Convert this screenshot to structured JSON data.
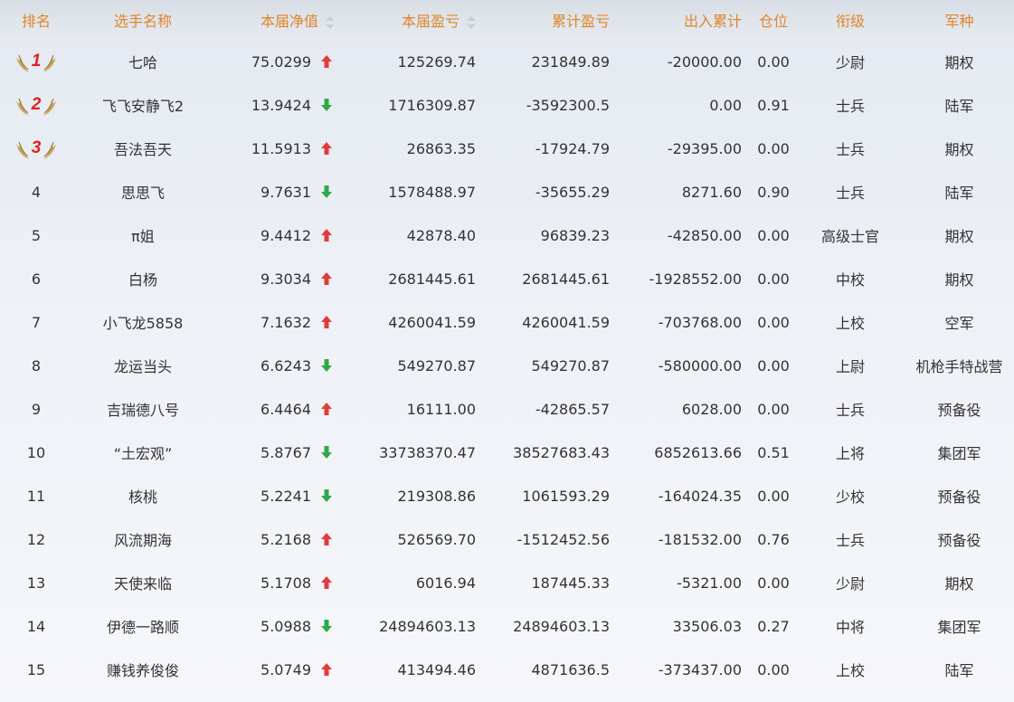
{
  "colors": {
    "header_text": "#e0862a",
    "up": "#e23b3b",
    "down": "#2fa84a",
    "medal_gold": "#c9a25a",
    "rank_red": "#e02020"
  },
  "headers": {
    "rank": "排名",
    "name": "选手名称",
    "nav": "本届净值",
    "pnl": "本届盈亏",
    "cum_pnl": "累计盈亏",
    "flow": "出入累计",
    "position": "仓位",
    "title": "衔级",
    "branch": "军种"
  },
  "rows": [
    {
      "rank": "1",
      "name": "七哈",
      "nav": "75.0299",
      "trend": "up",
      "pnl": "125269.74",
      "cum_pnl": "231849.89",
      "flow": "-20000.00",
      "position": "0.00",
      "title": "少尉",
      "branch": "期权"
    },
    {
      "rank": "2",
      "name": "飞飞安静飞2",
      "nav": "13.9424",
      "trend": "down",
      "pnl": "1716309.87",
      "cum_pnl": "-3592300.5",
      "flow": "0.00",
      "position": "0.91",
      "title": "士兵",
      "branch": "陆军"
    },
    {
      "rank": "3",
      "name": "吾法吾天",
      "nav": "11.5913",
      "trend": "up",
      "pnl": "26863.35",
      "cum_pnl": "-17924.79",
      "flow": "-29395.00",
      "position": "0.00",
      "title": "士兵",
      "branch": "期权"
    },
    {
      "rank": "4",
      "name": "思思飞",
      "nav": "9.7631",
      "trend": "down",
      "pnl": "1578488.97",
      "cum_pnl": "-35655.29",
      "flow": "8271.60",
      "position": "0.90",
      "title": "士兵",
      "branch": "陆军"
    },
    {
      "rank": "5",
      "name": "π姐",
      "nav": "9.4412",
      "trend": "up",
      "pnl": "42878.40",
      "cum_pnl": "96839.23",
      "flow": "-42850.00",
      "position": "0.00",
      "title": "高级士官",
      "branch": "期权"
    },
    {
      "rank": "6",
      "name": "白杨",
      "nav": "9.3034",
      "trend": "up",
      "pnl": "2681445.61",
      "cum_pnl": "2681445.61",
      "flow": "-1928552.00",
      "position": "0.00",
      "title": "中校",
      "branch": "期权"
    },
    {
      "rank": "7",
      "name": "小飞龙5858",
      "nav": "7.1632",
      "trend": "up",
      "pnl": "4260041.59",
      "cum_pnl": "4260041.59",
      "flow": "-703768.00",
      "position": "0.00",
      "title": "上校",
      "branch": "空军"
    },
    {
      "rank": "8",
      "name": "龙运当头",
      "nav": "6.6243",
      "trend": "down",
      "pnl": "549270.87",
      "cum_pnl": "549270.87",
      "flow": "-580000.00",
      "position": "0.00",
      "title": "上尉",
      "branch": "机枪手特战营"
    },
    {
      "rank": "9",
      "name": "吉瑞德八号",
      "nav": "6.4464",
      "trend": "up",
      "pnl": "16111.00",
      "cum_pnl": "-42865.57",
      "flow": "6028.00",
      "position": "0.00",
      "title": "士兵",
      "branch": "预备役"
    },
    {
      "rank": "10",
      "name": "“土宏观”",
      "nav": "5.8767",
      "trend": "down",
      "pnl": "33738370.47",
      "cum_pnl": "38527683.43",
      "flow": "6852613.66",
      "position": "0.51",
      "title": "上将",
      "branch": "集团军"
    },
    {
      "rank": "11",
      "name": "核桃",
      "nav": "5.2241",
      "trend": "down",
      "pnl": "219308.86",
      "cum_pnl": "1061593.29",
      "flow": "-164024.35",
      "position": "0.00",
      "title": "少校",
      "branch": "预备役"
    },
    {
      "rank": "12",
      "name": "风流期海",
      "nav": "5.2168",
      "trend": "up",
      "pnl": "526569.70",
      "cum_pnl": "-1512452.56",
      "flow": "-181532.00",
      "position": "0.76",
      "title": "士兵",
      "branch": "预备役"
    },
    {
      "rank": "13",
      "name": "天使来临",
      "nav": "5.1708",
      "trend": "up",
      "pnl": "6016.94",
      "cum_pnl": "187445.33",
      "flow": "-5321.00",
      "position": "0.00",
      "title": "少尉",
      "branch": "期权"
    },
    {
      "rank": "14",
      "name": "伊德一路顺",
      "nav": "5.0988",
      "trend": "down",
      "pnl": "24894603.13",
      "cum_pnl": "24894603.13",
      "flow": "33506.03",
      "position": "0.27",
      "title": "中将",
      "branch": "集团军"
    },
    {
      "rank": "15",
      "name": "赚钱养俊俊",
      "nav": "5.0749",
      "trend": "up",
      "pnl": "413494.46",
      "cum_pnl": "4871636.5",
      "flow": "-373437.00",
      "position": "0.00",
      "title": "上校",
      "branch": "陆军"
    }
  ]
}
